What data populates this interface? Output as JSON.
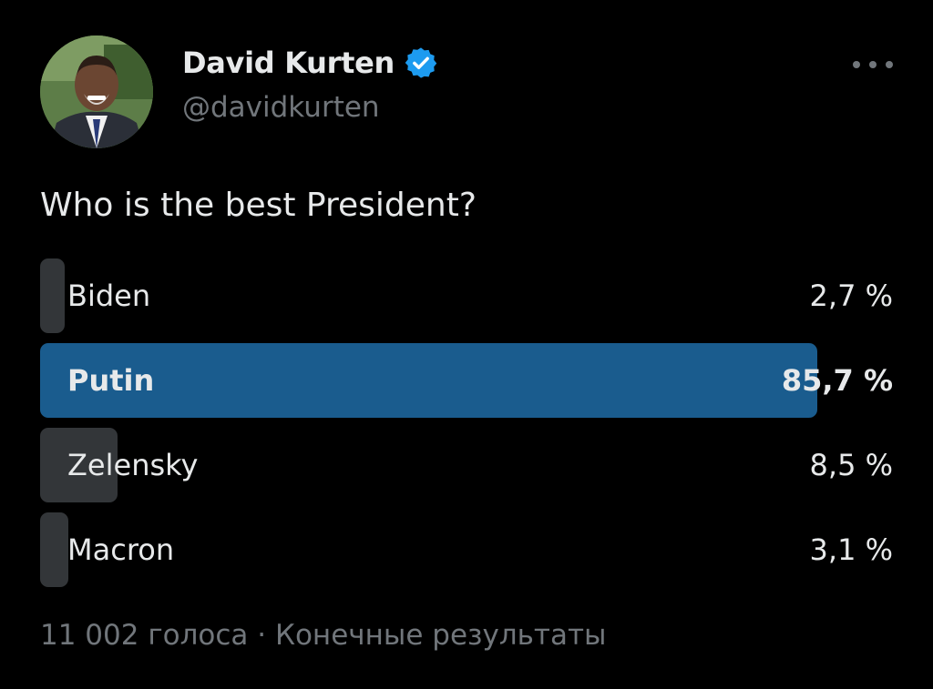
{
  "author": {
    "name": "David Kurten",
    "handle": "@davidkurten",
    "verified": true,
    "verified_color": "#1d9bf0",
    "avatar_icon": "profile-photo"
  },
  "tweet": {
    "question": "Who is the best President?",
    "more_icon": "ellipsis-icon"
  },
  "poll": {
    "options": [
      {
        "label": "Biden",
        "percent_text": "2,7 %",
        "percent": 2.7,
        "winner": false
      },
      {
        "label": "Putin",
        "percent_text": "85,7 %",
        "percent": 85.7,
        "winner": true
      },
      {
        "label": "Zelensky",
        "percent_text": "8,5 %",
        "percent": 8.5,
        "winner": false
      },
      {
        "label": "Macron",
        "percent_text": "3,1 %",
        "percent": 3.1,
        "winner": false
      }
    ],
    "footer": "11 002 голоса · Конечные результаты",
    "colors": {
      "winner_bar": "#1a5c8e",
      "other_bar": "#333639"
    }
  }
}
